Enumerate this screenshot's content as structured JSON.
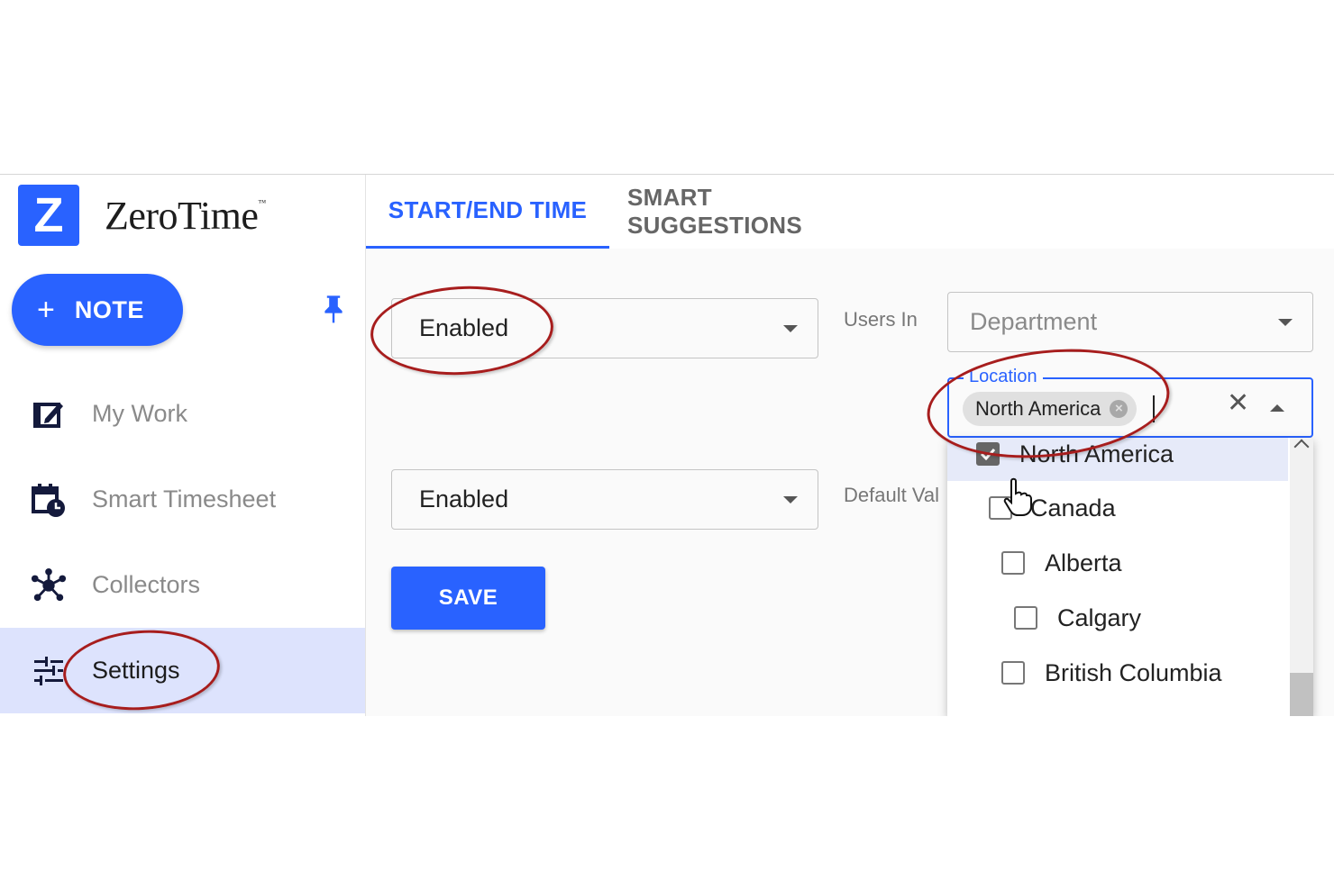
{
  "app": {
    "brand_letter": "Z",
    "brand_name": "ZeroTime",
    "brand_tm": "™",
    "accent_color": "#2962ff",
    "annotation_color": "#a71d1d"
  },
  "sidebar": {
    "note_button": {
      "icon": "plus-icon",
      "label": "NOTE"
    },
    "pin_icon": "pin-icon",
    "items": [
      {
        "label": "My Work",
        "icon": "edit-note-icon",
        "active": false
      },
      {
        "label": "Smart Timesheet",
        "icon": "calendar-clock-icon",
        "active": false
      },
      {
        "label": "Collectors",
        "icon": "network-hub-icon",
        "active": false
      },
      {
        "label": "Settings",
        "icon": "sliders-icon",
        "active": true
      }
    ]
  },
  "tabs": [
    {
      "label": "START/END TIME",
      "active": true
    },
    {
      "label": "SMART SUGGESTIONS",
      "active": false
    }
  ],
  "form": {
    "select_1": {
      "value": "Enabled"
    },
    "select_2": {
      "value": "Enabled"
    },
    "users_in_label": "Users In",
    "department_select": {
      "value": "Department"
    },
    "default_value_label": "Default Val",
    "location": {
      "legend": "Location",
      "chip": "North America",
      "dropdown_open": true
    },
    "save_label": "SAVE"
  },
  "location_options": [
    {
      "label": "North America",
      "checked": true,
      "level": 0
    },
    {
      "label": "Canada",
      "checked": false,
      "level": 0
    },
    {
      "label": "Alberta",
      "checked": false,
      "level": 1
    },
    {
      "label": "Calgary",
      "checked": false,
      "level": 2
    },
    {
      "label": "British Columbia",
      "checked": false,
      "level": 1
    }
  ]
}
